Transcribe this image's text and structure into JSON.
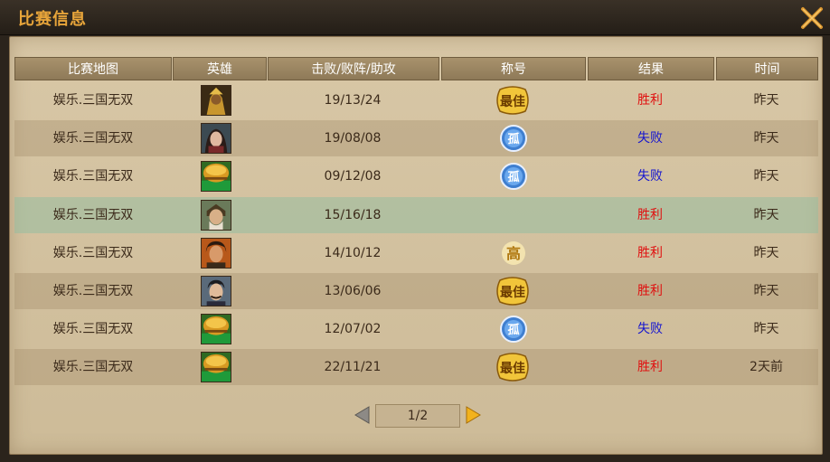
{
  "window": {
    "title": "比赛信息"
  },
  "columns": [
    "比赛地图",
    "英雄",
    "击败/败阵/助攻",
    "称号",
    "结果",
    "时间"
  ],
  "rows": [
    {
      "map": "娱乐.三国无双",
      "hero": "hero-1",
      "kda": "19/13/24",
      "badge": "最佳",
      "badge_type": "best",
      "result": "胜利",
      "result_type": "win",
      "time": "昨天"
    },
    {
      "map": "娱乐.三国无双",
      "hero": "hero-2",
      "kda": "19/08/08",
      "badge": "孤",
      "badge_type": "lone",
      "result": "失败",
      "result_type": "lose",
      "time": "昨天"
    },
    {
      "map": "娱乐.三国无双",
      "hero": "hero-3",
      "kda": "09/12/08",
      "badge": "孤",
      "badge_type": "lone",
      "result": "失败",
      "result_type": "lose",
      "time": "昨天"
    },
    {
      "map": "娱乐.三国无双",
      "hero": "hero-4",
      "kda": "15/16/18",
      "badge": "",
      "badge_type": "none",
      "result": "胜利",
      "result_type": "win",
      "time": "昨天"
    },
    {
      "map": "娱乐.三国无双",
      "hero": "hero-5",
      "kda": "14/10/12",
      "badge": "高",
      "badge_type": "ming",
      "result": "胜利",
      "result_type": "win",
      "time": "昨天"
    },
    {
      "map": "娱乐.三国无双",
      "hero": "hero-6",
      "kda": "13/06/06",
      "badge": "最佳",
      "badge_type": "best",
      "result": "胜利",
      "result_type": "win",
      "time": "昨天"
    },
    {
      "map": "娱乐.三国无双",
      "hero": "hero-3",
      "kda": "12/07/02",
      "badge": "孤",
      "badge_type": "lone",
      "result": "失败",
      "result_type": "lose",
      "time": "昨天"
    },
    {
      "map": "娱乐.三国无双",
      "hero": "hero-3",
      "kda": "22/11/21",
      "badge": "最佳",
      "badge_type": "best",
      "result": "胜利",
      "result_type": "win",
      "time": "2天前"
    }
  ],
  "pager": {
    "text": "1/2"
  },
  "colors": {
    "title": "#e8a53a",
    "win": "#e01010",
    "lose": "#1414d0"
  },
  "icons": {
    "close": "crossed-swords-icon",
    "prev": "arrow-left-icon",
    "next": "arrow-right-icon"
  }
}
